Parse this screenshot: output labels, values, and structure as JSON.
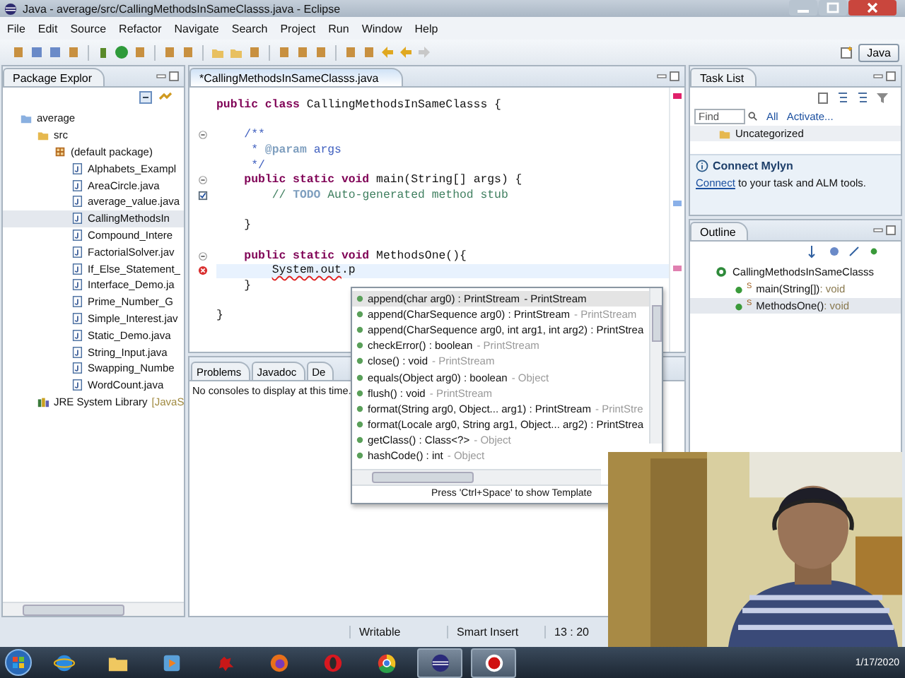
{
  "window": {
    "title": "Java - average/src/CallingMethodsInSameClasss.java - Eclipse"
  },
  "menu": [
    "File",
    "Edit",
    "Source",
    "Refactor",
    "Navigate",
    "Search",
    "Project",
    "Run",
    "Window",
    "Help"
  ],
  "perspective": {
    "label": "Java",
    "selected": true
  },
  "package_explorer": {
    "tab": {
      "label": "Package Explor",
      "selected": false
    },
    "tree": [
      {
        "label": "average",
        "kind": "project",
        "selected": false,
        "children": [
          {
            "label": "src",
            "kind": "folder",
            "selected": false,
            "children": [
              {
                "label": "(default package)",
                "kind": "package",
                "selected": false,
                "children": [
                  {
                    "label": "Alphabets_Exampl",
                    "kind": "file",
                    "selected": false
                  },
                  {
                    "label": "AreaCircle.java",
                    "kind": "file",
                    "selected": false
                  },
                  {
                    "label": "average_value.java",
                    "kind": "file",
                    "selected": false
                  },
                  {
                    "label": "CallingMethodsIn",
                    "kind": "file",
                    "selected": true
                  },
                  {
                    "label": "Compound_Intere",
                    "kind": "file",
                    "selected": false
                  },
                  {
                    "label": "FactorialSolver.jav",
                    "kind": "file",
                    "selected": false
                  },
                  {
                    "label": "If_Else_Statement_",
                    "kind": "file",
                    "selected": false
                  },
                  {
                    "label": "Interface_Demo.ja",
                    "kind": "file",
                    "selected": false
                  },
                  {
                    "label": "Prime_Number_G",
                    "kind": "file",
                    "selected": false
                  },
                  {
                    "label": "Simple_Interest.jav",
                    "kind": "file",
                    "selected": false
                  },
                  {
                    "label": "Static_Demo.java",
                    "kind": "file",
                    "selected": false
                  },
                  {
                    "label": "String_Input.java",
                    "kind": "file",
                    "selected": false
                  },
                  {
                    "label": "Swapping_Numbe",
                    "kind": "file",
                    "selected": false
                  },
                  {
                    "label": "WordCount.java",
                    "kind": "file",
                    "selected": false
                  }
                ]
              }
            ]
          },
          {
            "label": "JRE System Library",
            "suffix": "[JavaS",
            "kind": "library",
            "selected": false
          }
        ]
      }
    ]
  },
  "editor": {
    "tab": {
      "label": "*CallingMethodsInSameClasss.java",
      "selected": true
    },
    "lines": [
      {
        "kind": "code",
        "segments": [
          {
            "text": "public class",
            "kind": "keyword"
          },
          {
            "text": " CallingMethodsInSameClasss {",
            "kind": "plain"
          }
        ]
      },
      {
        "kind": "blank"
      },
      {
        "kind": "code",
        "gutter": {
          "kind": "fold"
        },
        "segments": [
          {
            "text": "    /**",
            "kind": "javadoc"
          }
        ]
      },
      {
        "kind": "code",
        "segments": [
          {
            "text": "     * ",
            "kind": "javadoc"
          },
          {
            "text": "@param",
            "kind": "tag"
          },
          {
            "text": " args",
            "kind": "javadoc"
          }
        ]
      },
      {
        "kind": "code",
        "segments": [
          {
            "text": "     */",
            "kind": "javadoc"
          }
        ]
      },
      {
        "kind": "code",
        "gutter": {
          "kind": "fold"
        },
        "segments": [
          {
            "text": "    public static void",
            "kind": "keyword"
          },
          {
            "text": " main(String[] args) {",
            "kind": "plain"
          }
        ]
      },
      {
        "kind": "code",
        "gutter": {
          "kind": "task"
        },
        "segments": [
          {
            "text": "        // ",
            "kind": "comment"
          },
          {
            "text": "TODO",
            "kind": "tag"
          },
          {
            "text": " Auto-generated method stub",
            "kind": "comment"
          }
        ]
      },
      {
        "kind": "blank"
      },
      {
        "kind": "code",
        "segments": [
          {
            "text": "    }",
            "kind": "plain"
          }
        ]
      },
      {
        "kind": "blank"
      },
      {
        "kind": "code",
        "gutter": {
          "kind": "fold"
        },
        "segments": [
          {
            "text": "    public static void",
            "kind": "keyword"
          },
          {
            "text": " MethodsOne(){",
            "kind": "plain"
          }
        ]
      },
      {
        "kind": "code",
        "gutter": {
          "kind": "error"
        },
        "current": true,
        "segments": [
          {
            "text": "        System.out",
            "kind": "error"
          },
          {
            "text": ".p",
            "kind": "plain"
          }
        ]
      },
      {
        "kind": "code",
        "segments": [
          {
            "text": "    }",
            "kind": "plain"
          }
        ]
      },
      {
        "kind": "blank"
      },
      {
        "kind": "code",
        "segments": [
          {
            "text": "}",
            "kind": "plain"
          }
        ]
      }
    ]
  },
  "completion": {
    "items": [
      {
        "signature": "append(char arg0) : PrintStream",
        "owner": "- PrintStream",
        "selected": true
      },
      {
        "signature": "append(CharSequence arg0) : PrintStream",
        "owner": "- PrintStream",
        "selected": false
      },
      {
        "signature": "append(CharSequence arg0, int arg1, int arg2) : PrintStrea",
        "selected": false
      },
      {
        "signature": "checkError() : boolean",
        "owner": "- PrintStream",
        "selected": false
      },
      {
        "signature": "close() : void",
        "owner": "- PrintStream",
        "selected": false
      },
      {
        "signature": "equals(Object arg0) : boolean",
        "owner": "- Object",
        "selected": false
      },
      {
        "signature": "flush() : void",
        "owner": "- PrintStream",
        "selected": false
      },
      {
        "signature": "format(String arg0, Object... arg1) : PrintStream",
        "owner": "- PrintStre",
        "selected": false
      },
      {
        "signature": "format(Locale arg0, String arg1, Object... arg2) : PrintStrea",
        "selected": false
      },
      {
        "signature": "getClass() : Class<?>",
        "owner": "- Object",
        "selected": false
      },
      {
        "signature": "hashCode() : int",
        "owner": "- Object",
        "selected": false
      }
    ],
    "footer": "Press 'Ctrl+Space' to show Template"
  },
  "bottom_panel": {
    "tabs": [
      {
        "label": "Problems",
        "selected": false
      },
      {
        "label": "Javadoc",
        "selected": false
      },
      {
        "label": "De",
        "selected": false
      }
    ],
    "message": "No consoles to display at this time."
  },
  "task_list": {
    "tab": {
      "label": "Task List",
      "selected": false
    },
    "find": {
      "placeholder": "Find"
    },
    "filters": [
      "All",
      "Activate..."
    ],
    "category": "Uncategorized"
  },
  "mylyn": {
    "title": "Connect Mylyn",
    "link": "Connect",
    "text": " to your task and ALM tools."
  },
  "outline": {
    "tab": {
      "label": "Outline",
      "selected": false
    },
    "tree": [
      {
        "name": "CallingMethodsInSameClasss",
        "kind": "class",
        "selected": false,
        "children": [
          {
            "name": "main(String[])",
            "modifier": "S",
            "type": " : void",
            "kind": "method",
            "selected": false
          },
          {
            "name": "MethodsOne()",
            "modifier": "S",
            "type": " : void",
            "kind": "method",
            "selected": true
          }
        ]
      }
    ]
  },
  "status_bar": {
    "mode": "Writable",
    "insert": "Smart Insert",
    "position": "13 : 20"
  },
  "webcam": {
    "kind": "picture"
  },
  "taskbar": {
    "apps": [
      {
        "kind": "ie",
        "active": false
      },
      {
        "kind": "folder",
        "active": false
      },
      {
        "kind": "media",
        "active": false
      },
      {
        "kind": "bug",
        "active": false
      },
      {
        "kind": "firefox",
        "active": false
      },
      {
        "kind": "opera",
        "active": false
      },
      {
        "kind": "chrome",
        "active": false
      },
      {
        "kind": "eclipse",
        "active": true
      },
      {
        "kind": "recorder",
        "active": true
      }
    ],
    "clock": "1/17/2020"
  }
}
